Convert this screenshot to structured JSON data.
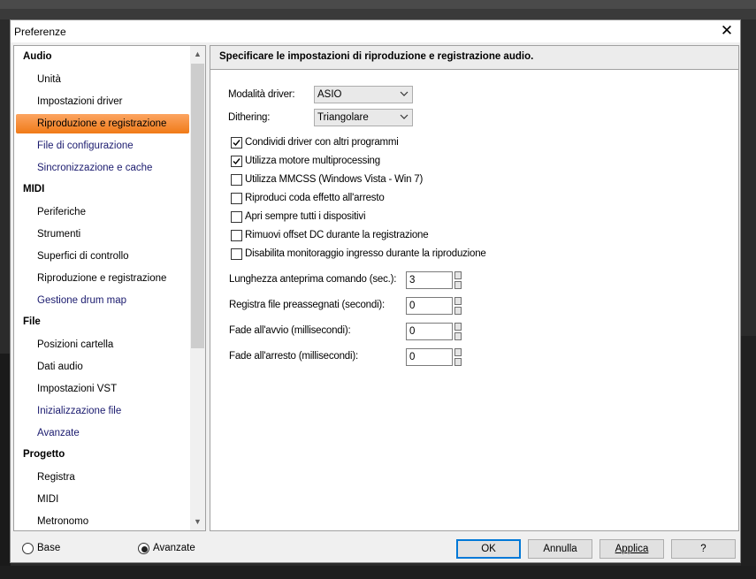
{
  "window": {
    "title": "Preferenze",
    "close_glyph": "✕"
  },
  "tree": {
    "categories": [
      "Audio",
      "MIDI",
      "File",
      "Progetto"
    ],
    "audio_items": [
      "Unità",
      "Impostazioni driver",
      "Riproduzione e registrazione",
      "File di configurazione",
      "Sincronizzazione e cache"
    ],
    "midi_items": [
      "Periferiche",
      "Strumenti",
      "Superfici di controllo",
      "Riproduzione e registrazione",
      "Gestione drum map"
    ],
    "file_items": [
      "Posizioni cartella",
      "Dati audio",
      "Impostazioni VST",
      "Inizializzazione file",
      "Avanzate"
    ],
    "progetto_items": [
      "Registra",
      "MIDI",
      "Metronomo"
    ],
    "selected": "Riproduzione e registrazione"
  },
  "panel": {
    "header": "Specificare le impostazioni di riproduzione e registrazione audio.",
    "driver_mode_label": "Modalità driver:",
    "driver_mode_value": "ASIO",
    "dithering_label": "Dithering:",
    "dithering_value": "Triangolare",
    "checkboxes": [
      {
        "label": "Condividi driver con altri programmi",
        "checked": true
      },
      {
        "label": "Utilizza motore multiprocessing",
        "checked": true
      },
      {
        "label": "Utilizza MMCSS (Windows Vista - Win 7)",
        "checked": false
      },
      {
        "label": "Riproduci coda effetto all'arresto",
        "checked": false
      },
      {
        "label": "Apri sempre tutti i dispositivi",
        "checked": false
      },
      {
        "label": "Rimuovi offset DC durante la registrazione",
        "checked": false
      },
      {
        "label": "Disabilita monitoraggio ingresso durante la riproduzione",
        "checked": false
      }
    ],
    "spinners": [
      {
        "label": "Lunghezza anteprima comando (sec.):",
        "value": "3"
      },
      {
        "label": "Registra file preassegnati (secondi):",
        "value": "0"
      },
      {
        "label": "Fade all'avvio (millisecondi):",
        "value": "0"
      },
      {
        "label": "Fade all'arresto (millisecondi):",
        "value": "0"
      }
    ]
  },
  "footer": {
    "radio_base": "Base",
    "radio_advanced": "Avanzate",
    "radio_selected": "Avanzate",
    "ok": "OK",
    "cancel": "Annulla",
    "apply": "Applica",
    "help": "?"
  }
}
